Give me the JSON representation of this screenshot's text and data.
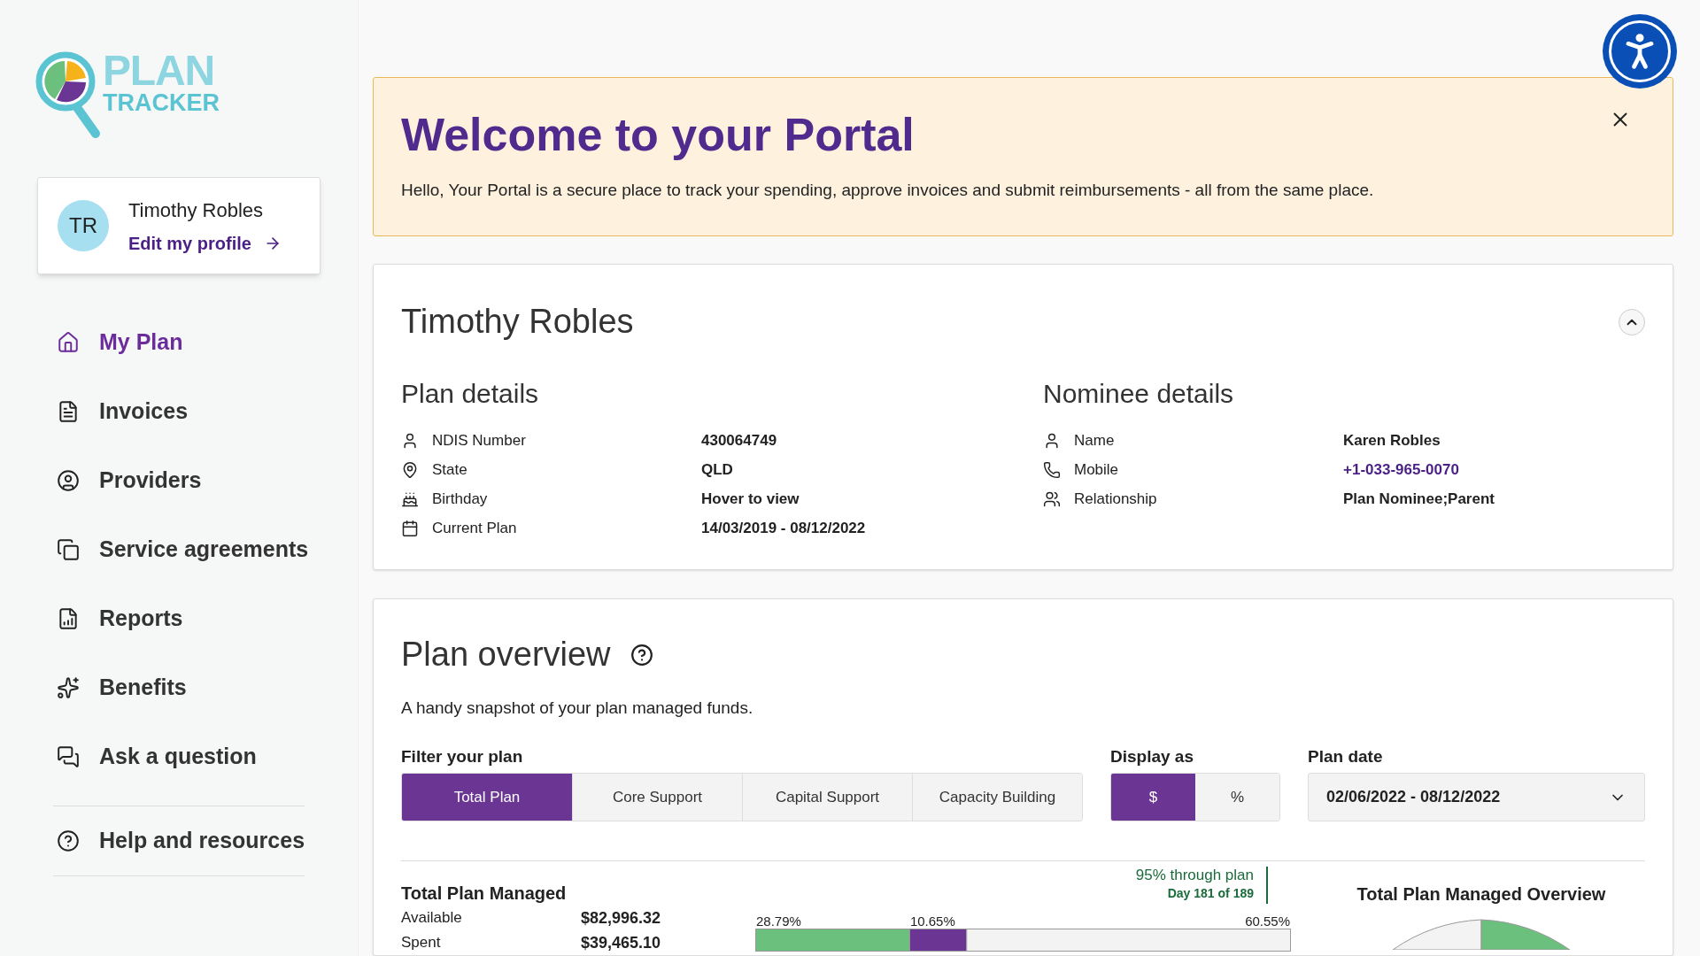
{
  "logo": {
    "line1": "PLAN",
    "line2": "TRACKER"
  },
  "profile": {
    "initials": "TR",
    "name": "Timothy Robles",
    "link": "Edit my profile"
  },
  "nav": [
    {
      "label": "My Plan",
      "selected": true
    },
    {
      "label": "Invoices",
      "selected": false
    },
    {
      "label": "Providers",
      "selected": false
    },
    {
      "label": "Service agreements",
      "selected": false
    },
    {
      "label": "Reports",
      "selected": false
    },
    {
      "label": "Benefits",
      "selected": false
    },
    {
      "label": "Ask a question",
      "selected": false
    }
  ],
  "nav_secondary": [
    {
      "label": "Help and resources",
      "selected": false
    }
  ],
  "banner": {
    "title": "Welcome to your Portal",
    "text": "Hello, Your Portal is a secure place to track your spending, approve invoices and submit reimbursements - all from the same place."
  },
  "participant": {
    "name": "Timothy Robles",
    "expanded": true,
    "plan_details": {
      "title": "Plan details",
      "rows": [
        {
          "label": "NDIS Number",
          "value": "430064749"
        },
        {
          "label": "State",
          "value": "QLD"
        },
        {
          "label": "Birthday",
          "value": "Hover to view"
        },
        {
          "label": "Current Plan",
          "value": "14/03/2019 - 08/12/2022"
        }
      ]
    },
    "nominee_details": {
      "title": "Nominee details",
      "rows": [
        {
          "label": "Name",
          "value": "Karen Robles",
          "kind": "text"
        },
        {
          "label": "Mobile",
          "value": "+1-033-965-0070",
          "kind": "link"
        },
        {
          "label": "Relationship",
          "value": "Plan Nominee;Parent",
          "kind": "text"
        }
      ]
    }
  },
  "overview": {
    "title": "Plan overview",
    "description": "A handy snapshot of your plan managed funds.",
    "filter": {
      "label": "Filter your plan",
      "options": [
        {
          "label": "Total Plan",
          "selected": true
        },
        {
          "label": "Core Support",
          "selected": false
        },
        {
          "label": "Capital Support",
          "selected": false
        },
        {
          "label": "Capacity Building",
          "selected": false
        }
      ]
    },
    "display": {
      "label": "Display as",
      "options": [
        {
          "label": "$",
          "selected": true
        },
        {
          "label": "%",
          "selected": false
        }
      ]
    },
    "plan_date": {
      "label": "Plan date",
      "value": "02/06/2022 - 08/12/2022"
    },
    "summary": {
      "title": "Total Plan Managed",
      "rows": [
        {
          "label": "Available",
          "value": "$82,996.32"
        },
        {
          "label": "Spent",
          "value": "$39,465.10"
        }
      ]
    },
    "progress": {
      "marker_text": "95% through plan",
      "marker_subtext": "Day 181 of 189",
      "chart_data": {
        "type": "bar",
        "orientation": "horizontal",
        "stacked": true,
        "series": [
          {
            "color": "#6cc07d",
            "values": [
              28.79
            ],
            "value_labels": [
              "28.79%"
            ]
          },
          {
            "color": "#6b3594",
            "values": [
              10.65
            ],
            "value_labels": [
              "10.65%"
            ]
          },
          {
            "color": "#f3f3f3",
            "values": [
              60.55
            ],
            "value_labels": [
              "60.55%"
            ]
          }
        ]
      }
    },
    "pie_title": "Total Plan Managed Overview"
  }
}
